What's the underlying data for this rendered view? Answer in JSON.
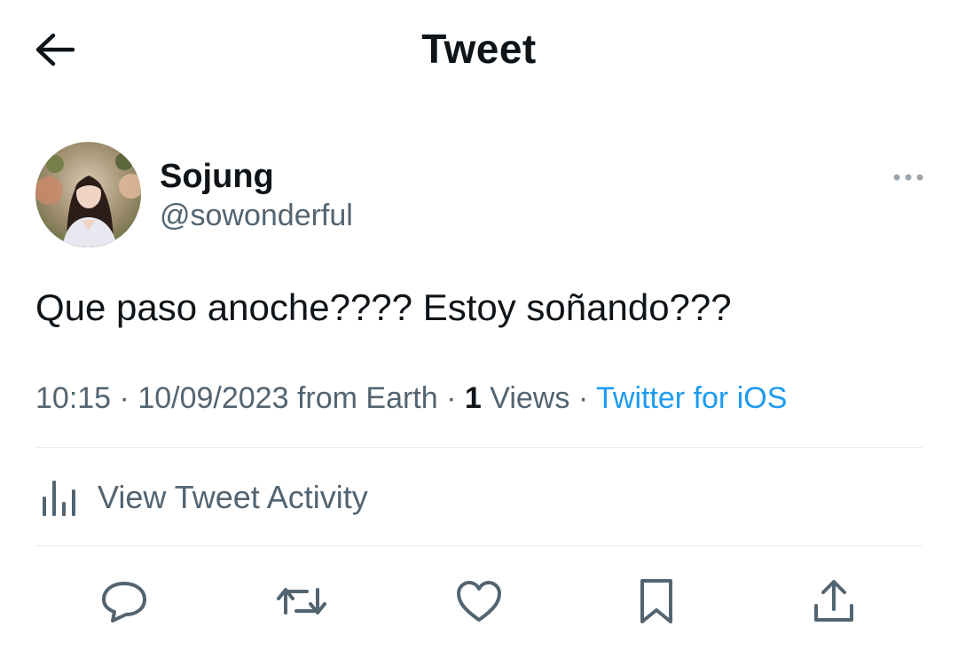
{
  "header": {
    "title": "Tweet",
    "back_icon": "arrow-left-icon"
  },
  "author": {
    "name": "Sojung",
    "handle": "@sowonderful",
    "avatar": "profile-photo"
  },
  "tweet": {
    "text": "Que paso anoche???? Estoy soñando???",
    "time": "10:15",
    "date": "10/09/2023",
    "location": "from Earth",
    "views_count": "1",
    "views_label": "Views",
    "source": "Twitter for iOS",
    "separator": "·"
  },
  "activity": {
    "label": "View Tweet Activity",
    "icon": "bar-chart-icon"
  },
  "actions": [
    {
      "name": "reply",
      "icon": "speech-bubble-icon"
    },
    {
      "name": "retweet",
      "icon": "retweet-icon"
    },
    {
      "name": "like",
      "icon": "heart-icon"
    },
    {
      "name": "bookmark",
      "icon": "bookmark-icon"
    },
    {
      "name": "share",
      "icon": "share-icon"
    }
  ],
  "colors": {
    "text_primary": "#0f1419",
    "text_secondary": "#536471",
    "link": "#1d9bf0",
    "divider": "#e6ecf0",
    "background": "#ffffff"
  }
}
